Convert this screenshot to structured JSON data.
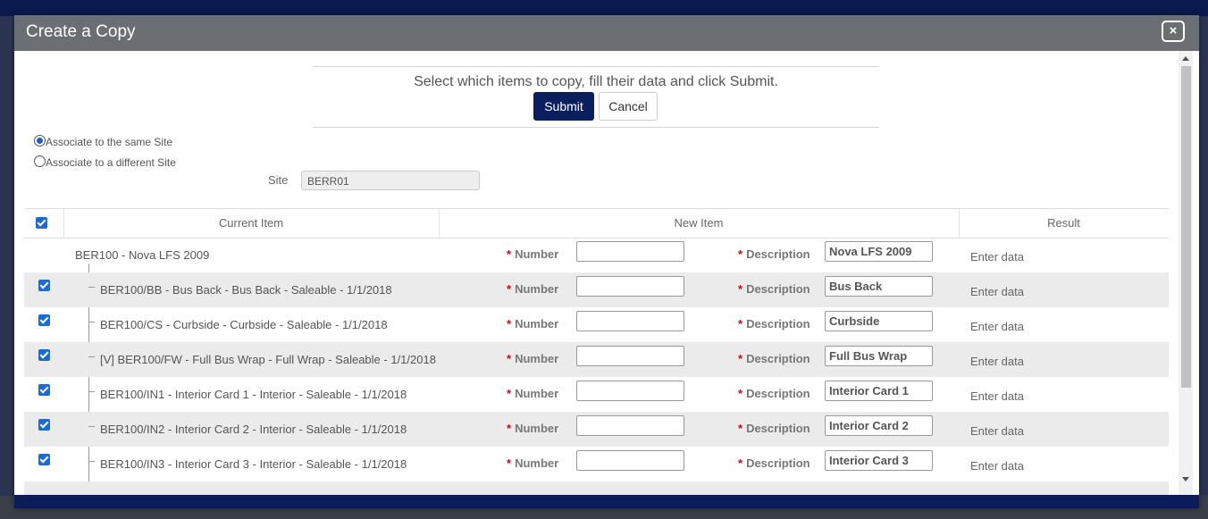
{
  "dialog": {
    "title": "Create a Copy",
    "close_label": "×"
  },
  "instructions": "Select which items to copy, fill their data and click Submit.",
  "buttons": {
    "submit": "Submit",
    "cancel": "Cancel"
  },
  "association": {
    "options": [
      "Associate to the same Site",
      "Associate to a different Site"
    ],
    "selected_index": 0
  },
  "site": {
    "label": "Site",
    "value": "BERR01"
  },
  "table": {
    "headers": {
      "current": "Current Item",
      "new": "New Item",
      "result": "Result"
    },
    "field_labels": {
      "required_mark": "*",
      "number": "Number",
      "description": "Description"
    },
    "parent": {
      "current": "BER100 - Nova LFS 2009",
      "description": "Nova LFS 2009",
      "result": "Enter data"
    },
    "rows": [
      {
        "current": "BER100/BB - Bus Back - Bus Back - Saleable - 1/1/2018",
        "description": "Bus Back",
        "result": "Enter data",
        "checked": true
      },
      {
        "current": "BER100/CS - Curbside - Curbside - Saleable - 1/1/2018",
        "description": "Curbside",
        "result": "Enter data",
        "checked": true
      },
      {
        "current": "[V] BER100/FW - Full Bus Wrap - Full Wrap - Saleable - 1/1/2018",
        "description": "Full Bus Wrap",
        "result": "Enter data",
        "checked": true
      },
      {
        "current": "BER100/IN1 - Interior Card 1 - Interior - Saleable - 1/1/2018",
        "description": "Interior Card 1",
        "result": "Enter data",
        "checked": true
      },
      {
        "current": "BER100/IN2 - Interior Card 2 - Interior - Saleable - 1/1/2018",
        "description": "Interior Card 2",
        "result": "Enter data",
        "checked": true
      },
      {
        "current": "BER100/IN3 - Interior Card 3 - Interior - Saleable - 1/1/2018",
        "description": "Interior Card 3",
        "result": "Enter data",
        "checked": true
      }
    ]
  },
  "colors": {
    "header_bg": "#6b6e72",
    "primary": "#0b1f5e",
    "required": "#d0021b",
    "checkbox": "#1a6ad8"
  }
}
